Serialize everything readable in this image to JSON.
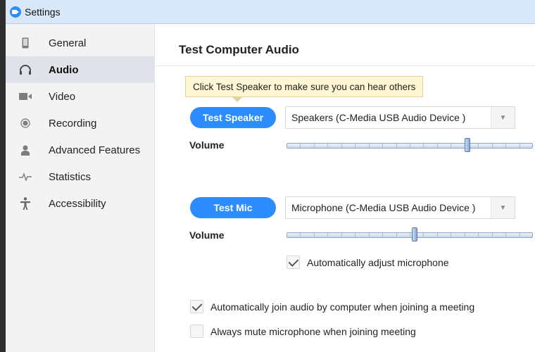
{
  "window": {
    "title": "Settings"
  },
  "sidebar": {
    "items": [
      {
        "label": "General",
        "icon": "phone-icon",
        "active": false
      },
      {
        "label": "Audio",
        "icon": "headphones-icon",
        "active": true
      },
      {
        "label": "Video",
        "icon": "video-camera-icon",
        "active": false
      },
      {
        "label": "Recording",
        "icon": "record-icon",
        "active": false
      },
      {
        "label": "Advanced Features",
        "icon": "person-icon",
        "active": false
      },
      {
        "label": "Statistics",
        "icon": "pulse-icon",
        "active": false
      },
      {
        "label": "Accessibility",
        "icon": "accessibility-icon",
        "active": false
      }
    ]
  },
  "main": {
    "title": "Test Computer Audio",
    "tooltip": "Click Test Speaker to make sure you can hear others",
    "speaker": {
      "button_label": "Test Speaker",
      "device": "Speakers (C-Media USB Audio Device  )",
      "volume_label": "Volume",
      "volume_level": 0.74
    },
    "mic": {
      "button_label": "Test Mic",
      "device": "Microphone (C-Media USB Audio Device  )",
      "volume_label": "Volume",
      "volume_level": 0.52,
      "auto_adjust_label": "Automatically adjust microphone",
      "auto_adjust_checked": true
    },
    "options": [
      {
        "label": "Automatically join audio by computer when joining a meeting",
        "checked": true
      },
      {
        "label": "Always mute microphone when joining meeting",
        "checked": false
      }
    ]
  },
  "colors": {
    "accent": "#2d8cff",
    "sidebar_active": "#dfe2e8",
    "titlebar": "#d9e8f8",
    "tooltip_bg": "#fff7d4"
  }
}
